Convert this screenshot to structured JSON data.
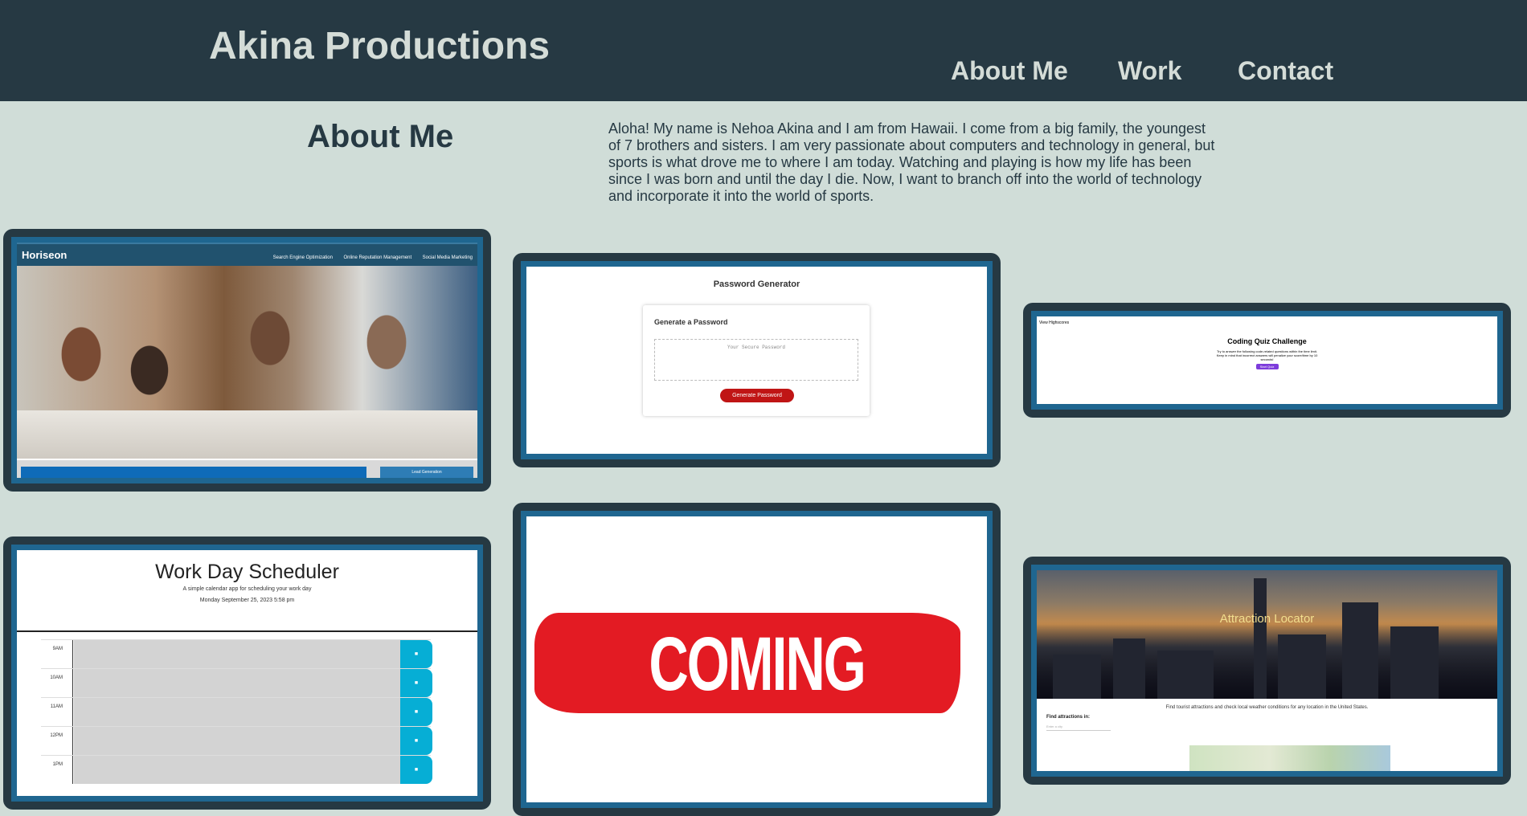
{
  "header": {
    "site_title": "Akina Productions",
    "nav": [
      "About Me",
      "Work",
      "Contact"
    ]
  },
  "about": {
    "heading": "About Me",
    "text": "Aloha! My name is Nehoa Akina and I am from Hawaii. I come from a big family, the youngest of 7 brothers and sisters. I am very passionate about computers and technology in general, but sports is what drove me to where I am today. Watching and playing is how my life has been since I was born and until the day I die. Now, I want to branch off into the world of technology and incorporate it into the world of sports."
  },
  "projects": {
    "horiseon": {
      "logo": "Horiseon",
      "nav": [
        "Search Engine Optimization",
        "Online Reputation Management",
        "Social Media Marketing"
      ],
      "lead_button": "Lead Generation"
    },
    "password": {
      "title": "Password Generator",
      "card_heading": "Generate a Password",
      "placeholder": "Your Secure Password",
      "button": "Generate Password"
    },
    "quiz": {
      "link": "View Highscores",
      "title": "Coding Quiz Challenge",
      "description": "Try to answer the following code-related questions within the time limit. Keep in mind that incorrect answers will penalize your score/time by 10 seconds!",
      "button": "Start Quiz"
    },
    "scheduler": {
      "title": "Work Day Scheduler",
      "subtitle": "A simple calendar app for scheduling your work day",
      "date": "Monday September 25, 2023 5:58 pm",
      "hours": [
        "9AM",
        "10AM",
        "11AM",
        "12PM",
        "1PM"
      ]
    },
    "coming_soon": {
      "text": "COMING SOON"
    },
    "attraction": {
      "title": "Attraction Locator",
      "description": "Find tourist attractions and check local weather conditions for any location in the United States.",
      "find_label": "Find attractions in:",
      "input_placeholder": "Enter a city"
    }
  },
  "colors": {
    "header_bg": "#263943",
    "page_bg": "#d0ddd8",
    "card_border": "#1f6690"
  }
}
